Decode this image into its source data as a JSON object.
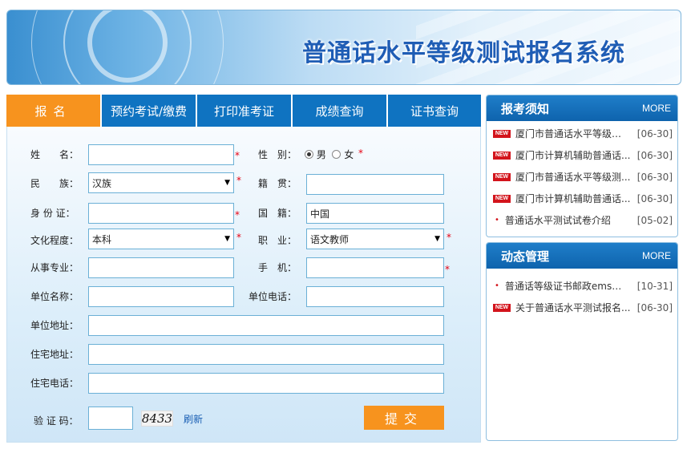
{
  "banner": {
    "title": "普通话水平等级测试报名系统"
  },
  "tabs": [
    {
      "label": "报名"
    },
    {
      "label": "预约考试/缴费"
    },
    {
      "label": "打印准考证"
    },
    {
      "label": "成绩查询"
    },
    {
      "label": "证书查询"
    }
  ],
  "form": {
    "name": {
      "label": "姓　　名：",
      "value": ""
    },
    "gender": {
      "label": "性　别：",
      "male": "男",
      "female": "女",
      "selected": "男"
    },
    "ethnicity": {
      "label": "民　　族：",
      "value": "汉族"
    },
    "native_place": {
      "label": "籍　贯：",
      "value": ""
    },
    "id_card": {
      "label": "身 份 证：",
      "value": ""
    },
    "nationality": {
      "label": "国　籍：",
      "value": "中国"
    },
    "education": {
      "label": "文化程度：",
      "value": "本科"
    },
    "occupation": {
      "label": "职　业：",
      "value": "语文教师"
    },
    "major": {
      "label": "从事专业：",
      "value": ""
    },
    "mobile": {
      "label": "手　机：",
      "value": ""
    },
    "employer": {
      "label": "单位名称：",
      "value": ""
    },
    "work_phone": {
      "label": "单位电话：",
      "value": ""
    },
    "work_address": {
      "label": "单位地址：",
      "value": ""
    },
    "home_address": {
      "label": "住宅地址：",
      "value": ""
    },
    "home_phone": {
      "label": "住宅电话：",
      "value": ""
    },
    "captcha": {
      "label": "验 证 码：",
      "value": "",
      "code": "8433",
      "refresh": "刷新"
    },
    "required_mark": "*",
    "submit": "提交"
  },
  "notice_panel": {
    "title": "报考须知",
    "more": "MORE",
    "items": [
      {
        "badge": "NEW",
        "title": "厦门市普通话水平等级测试...",
        "date": "[06-30]"
      },
      {
        "badge": "NEW",
        "title": "厦门市计算机辅助普通话...",
        "date": "[06-30]"
      },
      {
        "badge": "NEW",
        "title": "厦门市普通话水平等级测...",
        "date": "[06-30]"
      },
      {
        "badge": "NEW",
        "title": "厦门市计算机辅助普通话...",
        "date": "[06-30]"
      },
      {
        "badge": "",
        "title": "普通话水平测试试卷介绍",
        "date": "[05-02]"
      }
    ]
  },
  "news_panel": {
    "title": "动态管理",
    "more": "MORE",
    "items": [
      {
        "badge": "",
        "title": "普通话等级证书邮政ems送证...",
        "date": "[10-31]"
      },
      {
        "badge": "NEW",
        "title": "关于普通话水平测试报名...",
        "date": "[06-30]"
      }
    ]
  },
  "colors": {
    "accent_orange": "#f7931e",
    "tab_blue": "#0f73c1",
    "required_red": "#e60012"
  }
}
